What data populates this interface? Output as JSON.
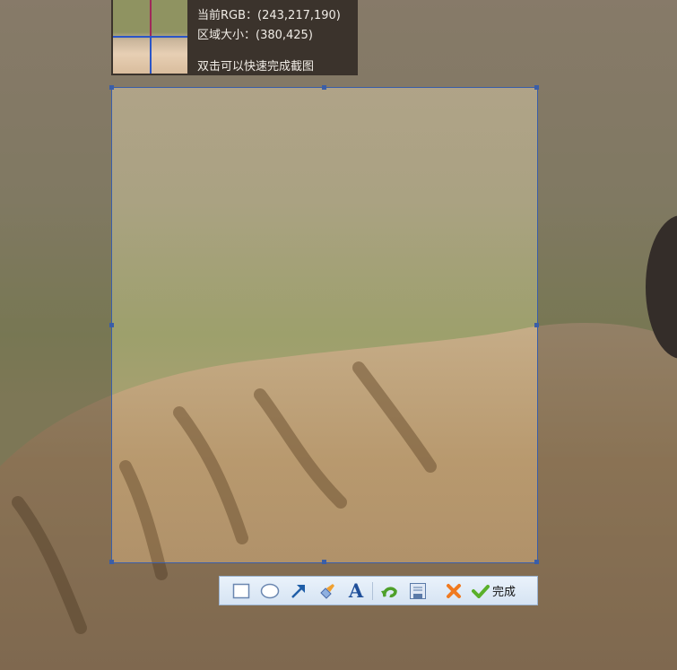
{
  "info_panel": {
    "rgb_label": "当前RGB：(243,217,190)",
    "size_label": "区域大小：(380,425)",
    "hint": "双击可以快速完成截图"
  },
  "toolbar": {
    "tools": [
      "rectangle-icon",
      "ellipse-icon",
      "arrow-icon",
      "brush-icon",
      "text-icon",
      "undo-icon",
      "save-icon",
      "cancel-icon"
    ],
    "done_label": "完成"
  },
  "colors": {
    "selection_border": "#3a5ea8",
    "toolbar_bg": "#dde9f5"
  }
}
